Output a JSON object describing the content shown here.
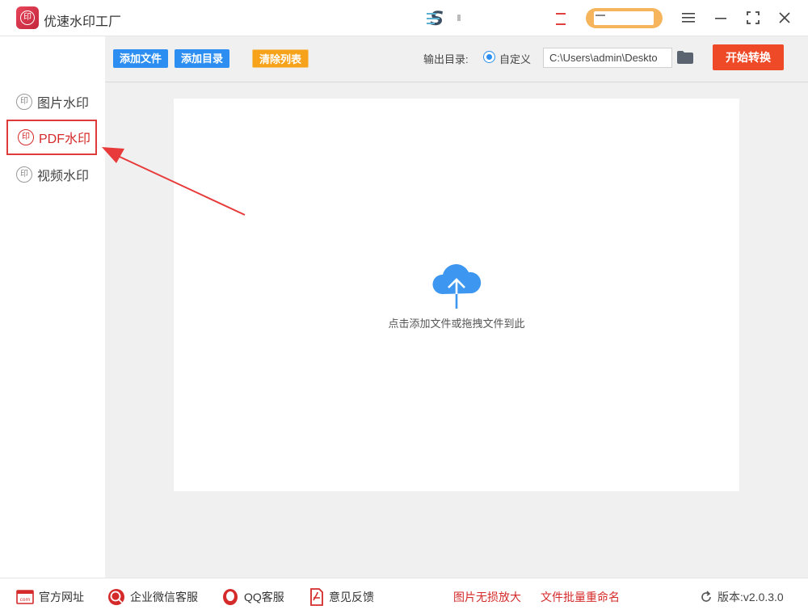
{
  "titlebar": {
    "app_title": "优速水印工厂",
    "logo_glyph": "印",
    "menu_icon": "menu-icon",
    "min_icon": "minimize-icon",
    "max_icon": "maximize-icon",
    "close_icon": "close-icon"
  },
  "sidebar": {
    "items": [
      {
        "label": "图片水印",
        "icon_glyph": "印",
        "active": false
      },
      {
        "label": "PDF水印",
        "icon_glyph": "印",
        "active": true
      },
      {
        "label": "视频水印",
        "icon_glyph": "印",
        "active": false
      }
    ]
  },
  "toolbar": {
    "add_file_label": "添加文件",
    "add_dir_label": "添加目录",
    "clear_list_label": "清除列表",
    "output_dir_label": "输出目录:",
    "custom_label": "自定义",
    "output_path": "C:\\Users\\admin\\Deskto",
    "start_label": "开始转换"
  },
  "dropzone": {
    "hint": "点击添加文件或拖拽文件到此"
  },
  "statusbar": {
    "website": "官方网址",
    "wechat_service": "企业微信客服",
    "qq_service": "QQ客服",
    "feedback": "意见反馈",
    "lossless_enlarge": "图片无损放大",
    "batch_rename": "文件批量重命名",
    "version": "版本:v2.0.3.0"
  },
  "colors": {
    "primary_blue": "#2b8ef0",
    "clear_orange": "#f7a21b",
    "start_red": "#ee4a28",
    "active_red": "#d42a2a"
  }
}
